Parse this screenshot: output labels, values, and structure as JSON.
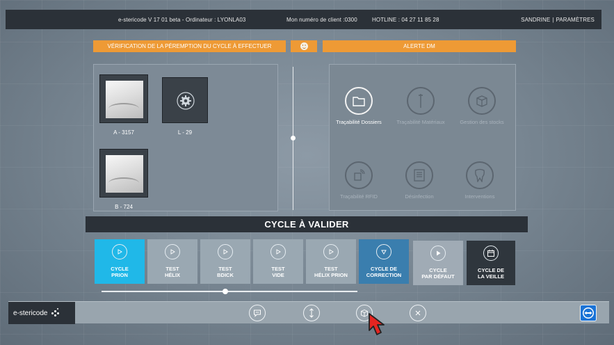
{
  "topbar": {
    "app_info": "e-stericode V 17  01  beta  -  Ordinateur : LYONLA03",
    "client_label": "Mon numéro de client :0300",
    "hotline_label": "HOTLINE :  04  27  11  85  28",
    "user_name": "SANDRINE",
    "separator": "|",
    "settings_label": "PARAMÈTRES"
  },
  "alerts": {
    "verification_label": "Vérification de la péremption du cycle à effectuer",
    "dm_alert_label": "ALERTE DM",
    "status_icon": "smiley-icon"
  },
  "machines": [
    {
      "label": "A - 3157",
      "kind": "photo"
    },
    {
      "label": "L - 29",
      "kind": "gear-icon"
    },
    {
      "label": "B - 724",
      "kind": "photo"
    }
  ],
  "modules": [
    {
      "label": "Traçabilité Dossiers",
      "icon": "folder-icon",
      "active": true
    },
    {
      "label": "Traçabilité Matériaux",
      "icon": "tool-icon",
      "active": false
    },
    {
      "label": "Gestion des stocks",
      "icon": "box-icon",
      "active": false
    },
    {
      "label": "Traçabilité RFID",
      "icon": "rfid-icon",
      "active": false
    },
    {
      "label": "Désinfection",
      "icon": "washer-icon",
      "active": false
    },
    {
      "label": "Interventions",
      "icon": "tooth-icon",
      "active": false
    }
  ],
  "cycle_header": "CYCLE À VALIDER",
  "cycles": [
    {
      "line1": "CYCLE",
      "line2": "PRION",
      "icon": "play-icon",
      "state": "selected"
    },
    {
      "line1": "TEST",
      "line2": "HÉLIX",
      "icon": "play-icon",
      "state": "normal"
    },
    {
      "line1": "TEST",
      "line2": "BDICK",
      "icon": "play-icon",
      "state": "normal"
    },
    {
      "line1": "TEST",
      "line2": "VIDE",
      "icon": "play-icon",
      "state": "normal"
    },
    {
      "line1": "TEST",
      "line2": "HÉLIX PRION",
      "icon": "play-icon",
      "state": "normal"
    },
    {
      "line1": "CYCLE  DE",
      "line2": "CORRECTION",
      "icon": "triangle-down-icon",
      "state": "highlight"
    },
    {
      "line1": "CYCLE",
      "line2": "PAR DÉFAUT",
      "icon": "play-icon",
      "state": "default"
    },
    {
      "line1": "CYCLE DE",
      "line2": "LA VEILLE",
      "icon": "calendar-icon",
      "state": "dark"
    }
  ],
  "bottombar": {
    "logo_text": "e-stericode",
    "actions": [
      "chat-icon",
      "vertical-arrows-icon",
      "package-icon",
      "close-icon"
    ],
    "remote_icon": "teamviewer-icon"
  },
  "colors": {
    "accent_orange": "#ee9a35",
    "selected_cyan": "#20b8e8",
    "highlight_blue": "#3a7eae",
    "dark_bar": "#2b3138"
  }
}
